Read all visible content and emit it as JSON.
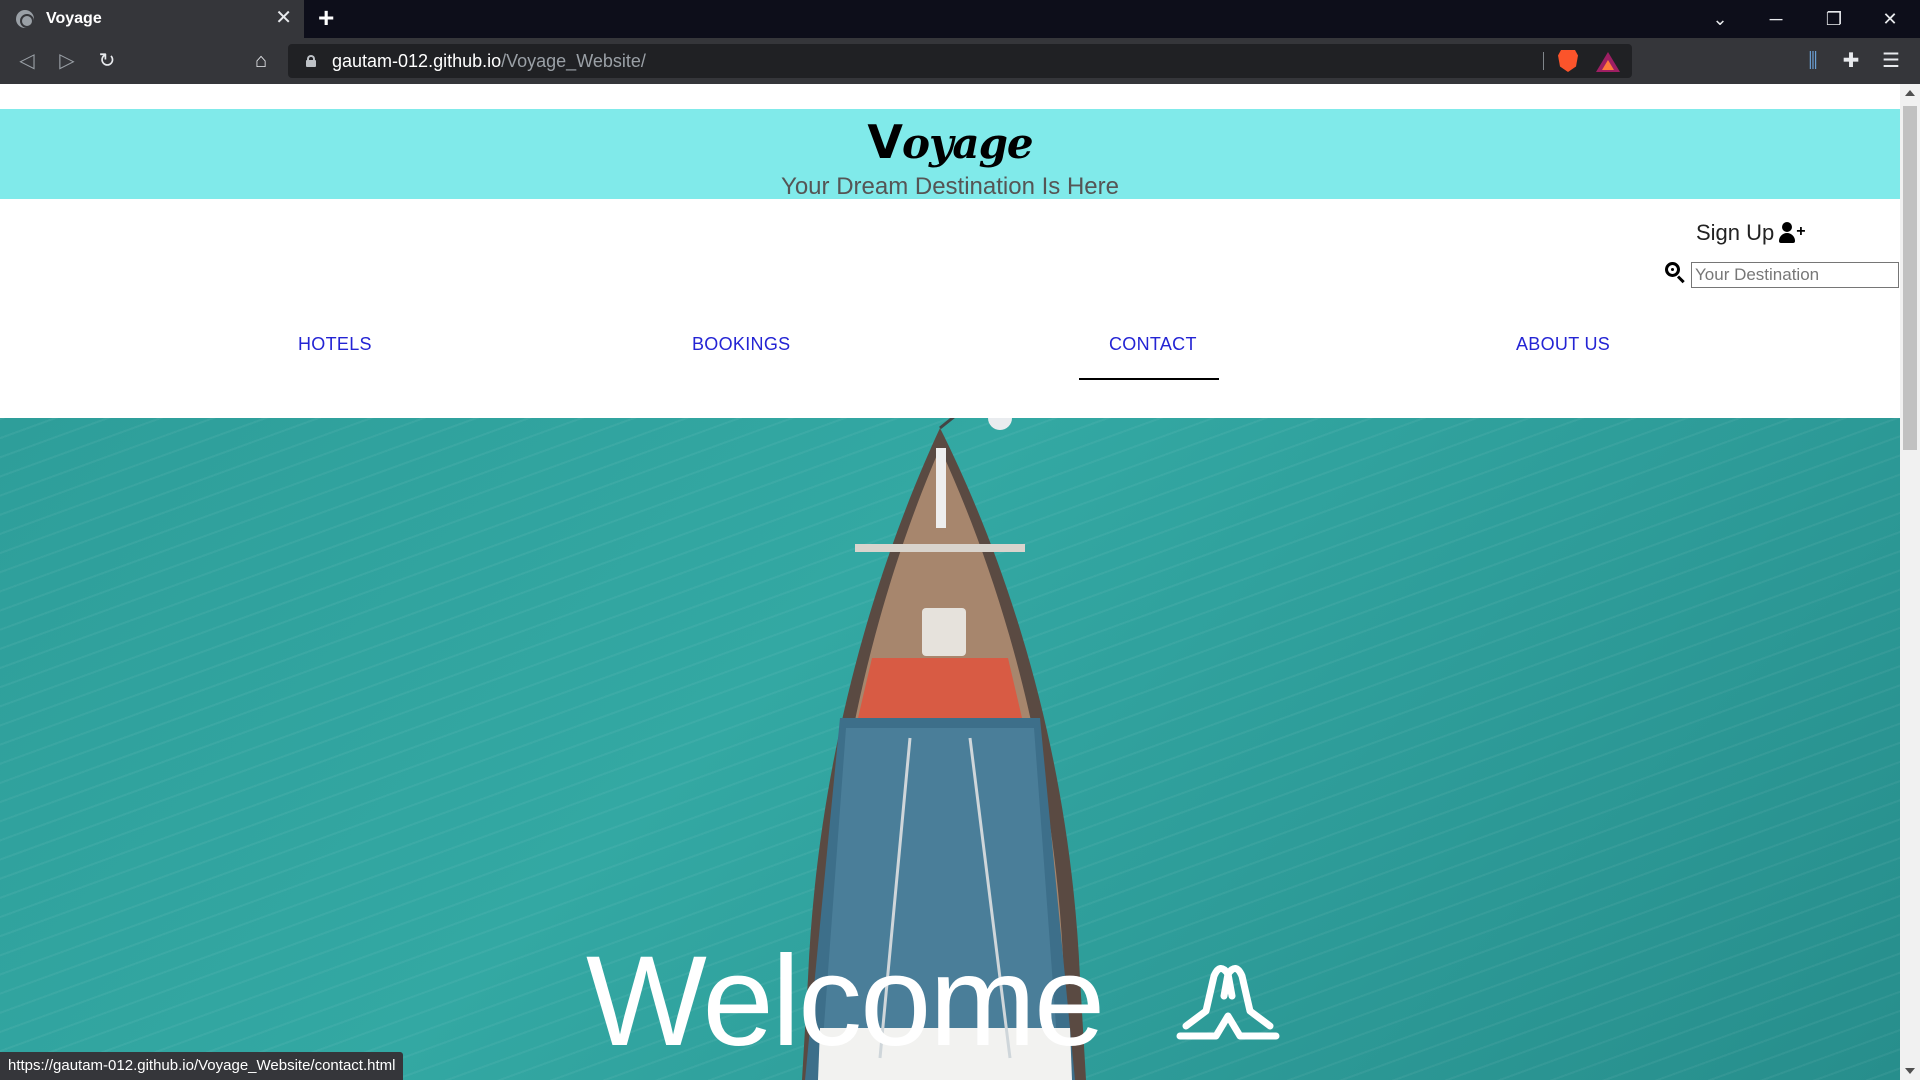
{
  "browser": {
    "tab_title": "Voyage",
    "url_host": "gautam-012.github.io",
    "url_path": "/Voyage_Website/",
    "status_url": "https://gautam-012.github.io/Voyage_Website/contact.html"
  },
  "header": {
    "logo_v": "V",
    "logo_rest": "oyage",
    "tagline": "Your Dream Destination Is Here"
  },
  "account": {
    "signup_label": "Sign Up"
  },
  "search": {
    "placeholder": "Your Destination"
  },
  "nav": {
    "items": [
      {
        "label": "HOTELS"
      },
      {
        "label": "BOOKINGS"
      },
      {
        "label": "CONTACT"
      },
      {
        "label": "ABOUT US"
      }
    ],
    "active": "CONTACT"
  },
  "hero": {
    "welcome": "Welcome"
  },
  "colors": {
    "banner": "#80eaea",
    "nav_link": "#2424d4",
    "hero_sea": "#2e9e9a"
  }
}
